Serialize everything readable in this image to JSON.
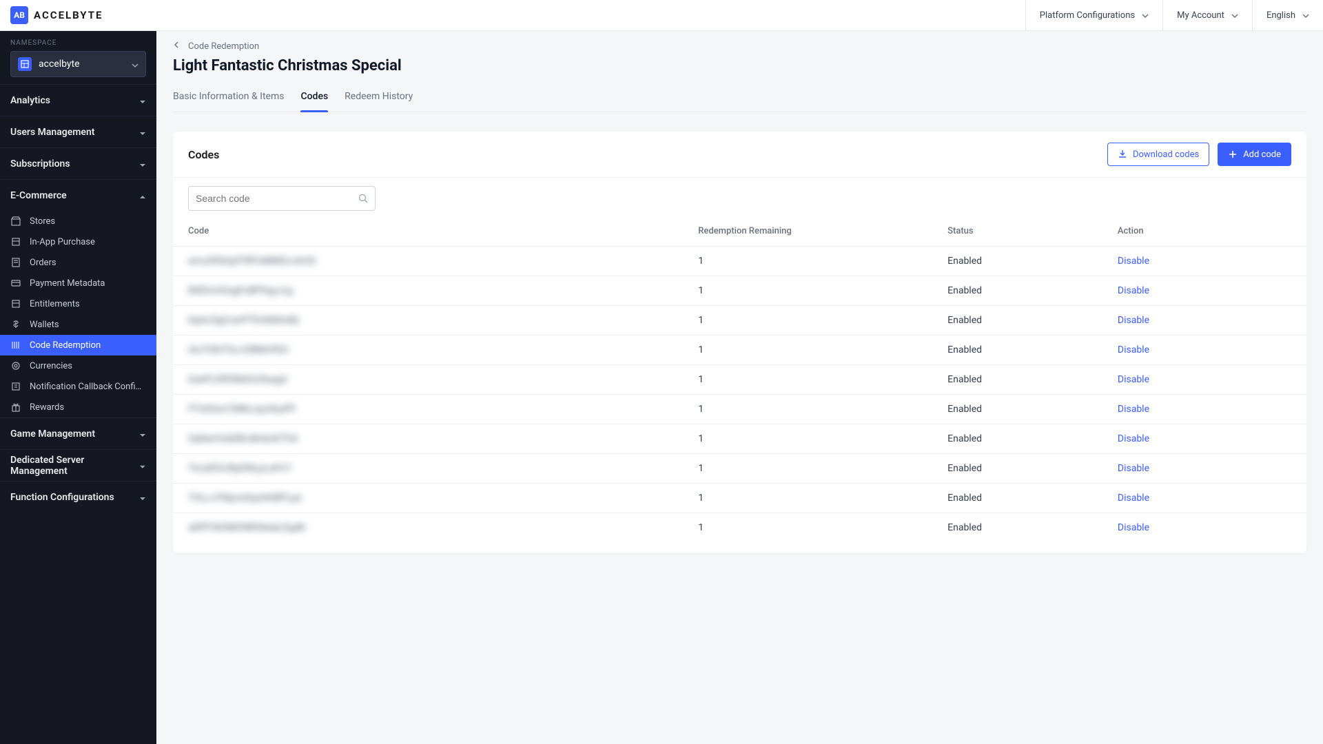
{
  "brand": {
    "badge": "AB",
    "name": "ACCELBYTE"
  },
  "topbar": {
    "platform": "Platform Configurations",
    "account": "My Account",
    "language": "English"
  },
  "sidebar": {
    "namespace_label": "NAMESPACE",
    "namespace_value": "accelbyte",
    "sections": {
      "analytics": "Analytics",
      "users": "Users Management",
      "subscriptions": "Subscriptions",
      "ecommerce": "E-Commerce",
      "game": "Game Management",
      "server": "Dedicated Server Management",
      "function": "Function Configurations"
    },
    "ecommerce_items": [
      {
        "label": "Stores",
        "icon": "store"
      },
      {
        "label": "In-App Purchase",
        "icon": "cart"
      },
      {
        "label": "Orders",
        "icon": "receipt"
      },
      {
        "label": "Payment Metadata",
        "icon": "card"
      },
      {
        "label": "Entitlements",
        "icon": "box"
      },
      {
        "label": "Wallets",
        "icon": "dollar"
      },
      {
        "label": "Code Redemption",
        "icon": "barcode",
        "active": true
      },
      {
        "label": "Currencies",
        "icon": "coin"
      },
      {
        "label": "Notification Callback Configu...",
        "icon": "bell"
      },
      {
        "label": "Rewards",
        "icon": "gift"
      }
    ]
  },
  "breadcrumb": "Code Redemption",
  "page_title": "Light Fantastic Christmas Special",
  "tabs": {
    "basic": "Basic Information & Items",
    "codes": "Codes",
    "history": "Redeem History"
  },
  "panel": {
    "title": "Codes",
    "download": "Download codes",
    "add": "Add code",
    "search_placeholder": "Search code"
  },
  "table": {
    "headers": {
      "code": "Code",
      "redemption": "Redemption Remaining",
      "status": "Status",
      "action": "Action"
    },
    "rows": [
      {
        "code": "amuXfbSqSTRPoMMDLmbVb",
        "remaining": "1",
        "status": "Enabled",
        "action": "Disable"
      },
      {
        "code": "BXEhchGagFuBPXqyJcg",
        "remaining": "1",
        "status": "Enabled",
        "action": "Disable"
      },
      {
        "code": "ktphcSgCswPTDnMdtoMj",
        "remaining": "1",
        "status": "Enabled",
        "action": "Disable"
      },
      {
        "code": "iALFtSbTGzJOBMnPbG",
        "remaining": "1",
        "status": "Enabled",
        "action": "Disable"
      },
      {
        "code": "baePLDR50kbScRaagd",
        "remaining": "1",
        "status": "Enabled",
        "action": "Disable"
      },
      {
        "code": "PToKSonTdMLoqchbaPfi",
        "remaining": "1",
        "status": "Enabled",
        "action": "Disable"
      },
      {
        "code": "SqNarHobEBcdknbnEThd",
        "remaining": "1",
        "status": "Enabled",
        "action": "Disable"
      },
      {
        "code": "TnLbEf4JRpDNLpLaPoT",
        "remaining": "1",
        "status": "Enabled",
        "action": "Disable"
      },
      {
        "code": "THLcJYNpnsSqwhhBPLpe",
        "remaining": "1",
        "status": "Enabled",
        "action": "Disable"
      },
      {
        "code": "aERTHkSMONRGkdaLDgdb",
        "remaining": "1",
        "status": "Enabled",
        "action": "Disable"
      }
    ]
  }
}
